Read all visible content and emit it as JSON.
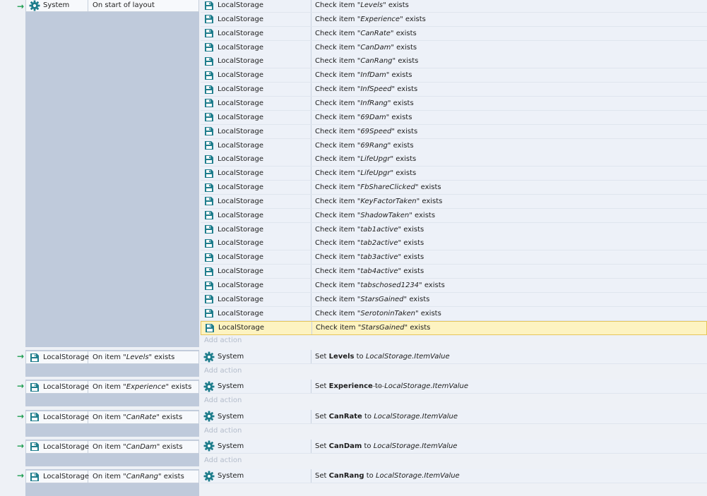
{
  "event1": {
    "object": "System",
    "condition": "On start of layout",
    "actions": [
      {
        "object": "LocalStorage",
        "prefix": "Check item ",
        "item": "\"Levels\"",
        "suffix": " exists"
      },
      {
        "object": "LocalStorage",
        "prefix": "Check item ",
        "item": "\"Experience\"",
        "suffix": " exists"
      },
      {
        "object": "LocalStorage",
        "prefix": "Check item ",
        "item": "\"CanRate\"",
        "suffix": " exists"
      },
      {
        "object": "LocalStorage",
        "prefix": "Check item ",
        "item": "\"CanDam\"",
        "suffix": " exists"
      },
      {
        "object": "LocalStorage",
        "prefix": "Check item ",
        "item": "\"CanRang\"",
        "suffix": " exists"
      },
      {
        "object": "LocalStorage",
        "prefix": "Check item ",
        "item": "\"InfDam\"",
        "suffix": " exists"
      },
      {
        "object": "LocalStorage",
        "prefix": "Check item ",
        "item": "\"InfSpeed\"",
        "suffix": " exists"
      },
      {
        "object": "LocalStorage",
        "prefix": "Check item ",
        "item": "\"InfRang\"",
        "suffix": " exists"
      },
      {
        "object": "LocalStorage",
        "prefix": "Check item ",
        "item": "\"69Dam\"",
        "suffix": " exists"
      },
      {
        "object": "LocalStorage",
        "prefix": "Check item ",
        "item": "\"69Speed\"",
        "suffix": " exists"
      },
      {
        "object": "LocalStorage",
        "prefix": "Check item ",
        "item": "\"69Rang\"",
        "suffix": " exists"
      },
      {
        "object": "LocalStorage",
        "prefix": "Check item ",
        "item": "\"LifeUpgr\"",
        "suffix": " exists"
      },
      {
        "object": "LocalStorage",
        "prefix": "Check item ",
        "item": "\"LifeUpgr\"",
        "suffix": " exists"
      },
      {
        "object": "LocalStorage",
        "prefix": "Check item ",
        "item": "\"FbShareClicked\"",
        "suffix": " exists"
      },
      {
        "object": "LocalStorage",
        "prefix": "Check item ",
        "item": "\"KeyFactorTaken\"",
        "suffix": " exists"
      },
      {
        "object": "LocalStorage",
        "prefix": "Check item ",
        "item": "\"ShadowTaken\"",
        "suffix": " exists"
      },
      {
        "object": "LocalStorage",
        "prefix": "Check item ",
        "item": "\"tab1active\"",
        "suffix": " exists"
      },
      {
        "object": "LocalStorage",
        "prefix": "Check item ",
        "item": "\"tab2active\"",
        "suffix": " exists"
      },
      {
        "object": "LocalStorage",
        "prefix": "Check item ",
        "item": "\"tab3active\"",
        "suffix": " exists"
      },
      {
        "object": "LocalStorage",
        "prefix": "Check item ",
        "item": "\"tab4active\"",
        "suffix": " exists"
      },
      {
        "object": "LocalStorage",
        "prefix": "Check item ",
        "item": "\"tabschosed1234\"",
        "suffix": " exists"
      },
      {
        "object": "LocalStorage",
        "prefix": "Check item ",
        "item": "\"StarsGained\"",
        "suffix": " exists"
      },
      {
        "object": "LocalStorage",
        "prefix": "Check item ",
        "item": "\"SerotoninTaken\"",
        "suffix": " exists"
      },
      {
        "object": "LocalStorage",
        "prefix": "Check item ",
        "item": "\"StarsGained\"",
        "suffix": " exists"
      }
    ],
    "add_action": "Add action"
  },
  "events": [
    {
      "object": "LocalStorage",
      "cond_prefix": "On item ",
      "cond_item": "\"Levels\"",
      "cond_suffix": " exists",
      "act_object": "System",
      "act_prefix": "Set ",
      "act_var": "Levels",
      "act_mid": " to ",
      "act_expr": "LocalStorage.ItemValue",
      "add_action": "Add action"
    },
    {
      "object": "LocalStorage",
      "cond_prefix": "On item ",
      "cond_item": "\"Experience\"",
      "cond_suffix": " exists",
      "act_object": "System",
      "act_prefix": "Set ",
      "act_var": "Experience",
      "act_mid": " to ",
      "act_expr": "LocalStorage.ItemValue",
      "add_action": "Add action"
    },
    {
      "object": "LocalStorage",
      "cond_prefix": "On item ",
      "cond_item": "\"CanRate\"",
      "cond_suffix": " exists",
      "act_object": "System",
      "act_prefix": "Set ",
      "act_var": "CanRate",
      "act_mid": " to ",
      "act_expr": "LocalStorage.ItemValue",
      "add_action": "Add action"
    },
    {
      "object": "LocalStorage",
      "cond_prefix": "On item ",
      "cond_item": "\"CanDam\"",
      "cond_suffix": " exists",
      "act_object": "System",
      "act_prefix": "Set ",
      "act_var": "CanDam",
      "act_mid": " to ",
      "act_expr": "LocalStorage.ItemValue",
      "add_action": "Add action"
    },
    {
      "object": "LocalStorage",
      "cond_prefix": "On item ",
      "cond_item": "\"CanRang\"",
      "cond_suffix": " exists",
      "act_object": "System",
      "act_prefix": "Set ",
      "act_var": "CanRang",
      "act_mid": " to ",
      "act_expr": "LocalStorage.ItemValue",
      "add_action": ""
    }
  ],
  "colors": {
    "accent": "#1e7d8c",
    "arrow": "#1e9e50",
    "selected": "#fdf3c1"
  }
}
